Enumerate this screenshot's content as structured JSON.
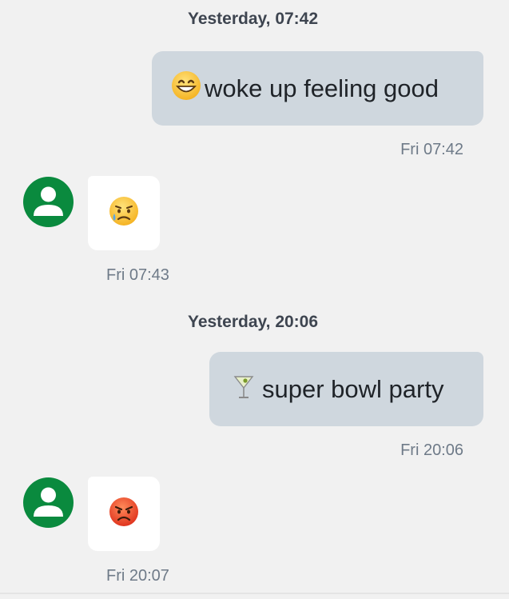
{
  "conversation": {
    "groups": [
      {
        "day_header": "Yesterday, 07:42",
        "outgoing": {
          "emoji_icon": "grinning-face-icon",
          "text": "woke up feeling good",
          "time": "Fri 07:42"
        },
        "incoming": {
          "emoji_icon": "sad-but-relieved-face-icon",
          "time": "Fri 07:43"
        }
      },
      {
        "day_header": "Yesterday, 20:06",
        "outgoing": {
          "emoji_icon": "cocktail-glass-icon",
          "text": "super bowl party",
          "time": "Fri 20:06"
        },
        "incoming": {
          "emoji_icon": "pouting-face-icon",
          "time": "Fri 20:07"
        }
      }
    ]
  },
  "colors": {
    "background": "#f1f1f1",
    "outgoing_bubble": "#cfd7de",
    "incoming_bubble": "#ffffff",
    "avatar": "#0a8a3e",
    "timestamp": "#6e7a88",
    "header": "#3e4550"
  }
}
